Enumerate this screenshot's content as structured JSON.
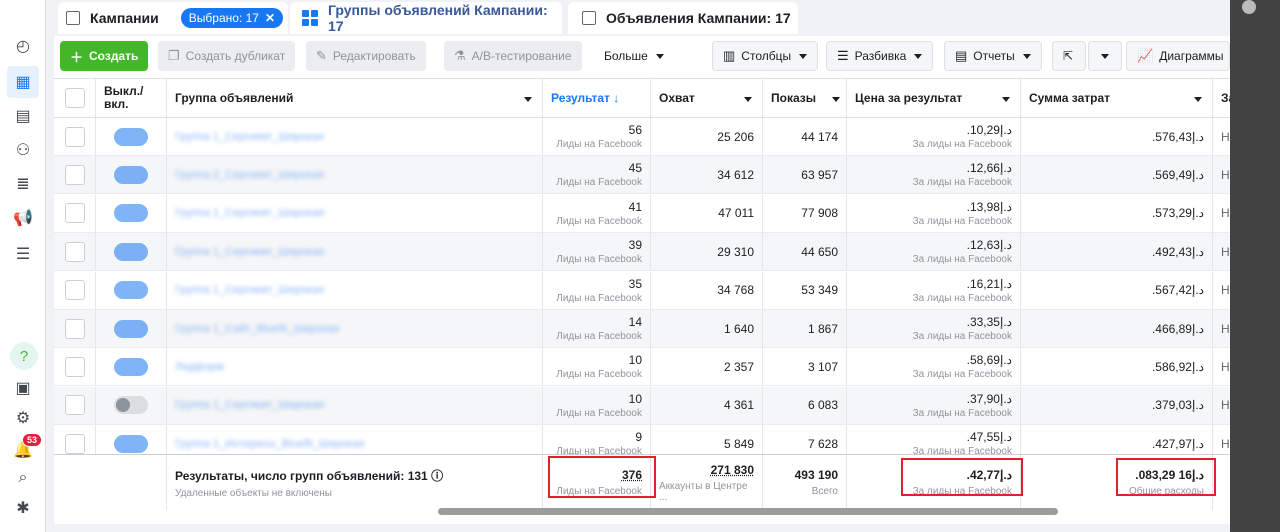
{
  "tabs": {
    "campaigns": "Кампании",
    "selected_chip": "Выбрано: 17",
    "adsets": "Группы объявлений Кампании: 17",
    "ads": "Объявления Кампании: 17"
  },
  "toolbar": {
    "create": "Создать",
    "duplicate": "Создать дубликат",
    "edit": "Редактировать",
    "ab_test": "A/B-тестирование",
    "more": "Больше",
    "columns": "Столбцы",
    "breakdown": "Разбивка",
    "reports": "Отчеты",
    "charts": "Диаграммы"
  },
  "headers": {
    "onoff": "Выкл./\nвкл.",
    "adset": "Группа объявлений",
    "result": "Результат ↓",
    "reach": "Охват",
    "impressions": "Показы",
    "cpr": "Цена за результат",
    "spent": "Сумма затрат",
    "next": "За"
  },
  "rows": [
    {
      "name": "Группа 1_Сергиевт_Широкая",
      "on": true,
      "result": "56",
      "reach": "25 206",
      "impr": "44 174",
      "cpr": ".د.إ10,29",
      "spent": ".د.إ576,43",
      "next": "Н"
    },
    {
      "name": "Группа 2_Сергиевт_Широкая",
      "on": true,
      "result": "45",
      "reach": "34 612",
      "impr": "63 957",
      "cpr": ".د.إ12,66",
      "spent": ".د.إ569,49",
      "next": "Не"
    },
    {
      "name": "Группа 1_Сергиевт_Широкая",
      "on": true,
      "result": "41",
      "reach": "47 011",
      "impr": "77 908",
      "cpr": ".د.إ13,98",
      "spent": ".د.إ573,29",
      "next": "Не"
    },
    {
      "name": "Группа 1_Сергиевт_Широкая",
      "on": true,
      "result": "39",
      "reach": "29 310",
      "impr": "44 650",
      "cpr": ".د.إ12,63",
      "spent": ".د.إ492,43",
      "next": "Не"
    },
    {
      "name": "Группа 1_Сергиевт_Широкая",
      "on": true,
      "result": "35",
      "reach": "34 768",
      "impr": "53 349",
      "cpr": ".د.إ16,21",
      "spent": ".د.إ567,42",
      "next": "Не"
    },
    {
      "name": "Группа 1_Сайт_Bluefit_Широкая",
      "on": true,
      "result": "14",
      "reach": "1 640",
      "impr": "1 867",
      "cpr": ".د.إ33,35",
      "spent": ".د.إ466,89",
      "next": "Не"
    },
    {
      "name": "Лидформ",
      "on": true,
      "result": "10",
      "reach": "2 357",
      "impr": "3 107",
      "cpr": ".د.إ58,69",
      "spent": ".د.إ586,92",
      "next": "Не"
    },
    {
      "name": "Группа 1_Сергиевт_Широкая",
      "on": false,
      "result": "10",
      "reach": "4 361",
      "impr": "6 083",
      "cpr": ".د.إ37,90",
      "spent": ".د.إ379,03",
      "next": "Не"
    },
    {
      "name": "Группа 1_Интересы_Bluefit_Широкая",
      "on": true,
      "result": "9",
      "reach": "5 849",
      "impr": "7 628",
      "cpr": ".د.إ47,55",
      "spent": ".د.إ427,97",
      "next": "Не"
    }
  ],
  "row_sub": {
    "result": "Лиды на Facebook",
    "cpr": "За лиды на Facebook"
  },
  "footer": {
    "title": "Результаты, число групп объявлений: 131",
    "subtitle": "Удаленные объекты не включены",
    "result": "376",
    "result_sub": "Лиды на Facebook",
    "reach": "271 830",
    "reach_sub": "Аккаунты в Центре ...",
    "impr": "493 190",
    "impr_sub": "Всего",
    "cpr": ".د.إ42,77",
    "cpr_sub": "За лиды на Facebook",
    "spent": ".د.إ16 083,29",
    "spent_sub": "Общие расходы"
  },
  "badge_count": "53",
  "accent": "#1877f2",
  "highlight": "#e0202c"
}
